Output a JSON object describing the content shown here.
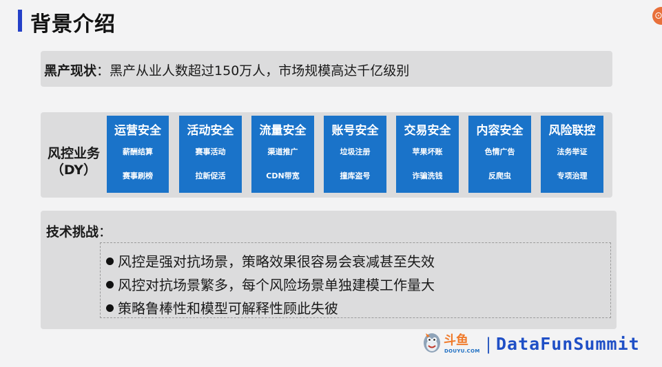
{
  "header": {
    "title": "背景介绍"
  },
  "status": {
    "label": "黑产现状",
    "sep": "：",
    "text": "黑产从业人数超过150万人，市场规模高达千亿级别"
  },
  "business": {
    "label_line1": "风控业务",
    "label_line2": "（DY）",
    "cards": [
      {
        "title": "运营安全",
        "items": [
          "薪酬结算",
          "赛事刷榜"
        ]
      },
      {
        "title": "活动安全",
        "items": [
          "赛事活动",
          "拉新促活"
        ]
      },
      {
        "title": "流量安全",
        "items": [
          "渠道推广",
          "CDN带宽"
        ]
      },
      {
        "title": "账号安全",
        "items": [
          "垃圾注册",
          "撞库盗号"
        ]
      },
      {
        "title": "交易安全",
        "items": [
          "苹果坏账",
          "诈骗洗钱"
        ]
      },
      {
        "title": "内容安全",
        "items": [
          "色情广告",
          "反爬虫"
        ]
      },
      {
        "title": "风险联控",
        "items": [
          "法务举证",
          "专项治理"
        ]
      }
    ]
  },
  "tech": {
    "label": "技术挑战",
    "sep": "：",
    "bullets": [
      "风控是强对抗场景，策略效果很容易会衰减甚至失效",
      "风控对抗场景繁多，每个风险场景单独建模工作量大",
      "策略鲁棒性和模型可解释性顾此失彼"
    ]
  },
  "footer": {
    "logo_cn": "斗鱼",
    "logo_en": "DOUYU.COM",
    "separator": "|",
    "brand": "DataFunSummit"
  },
  "colors": {
    "accent": "#2440c8",
    "card_blue": "#1a73c9",
    "panel_gray": "#dcdcdd",
    "logo_orange": "#f07a2a",
    "brand_blue": "#1f4fc6"
  }
}
